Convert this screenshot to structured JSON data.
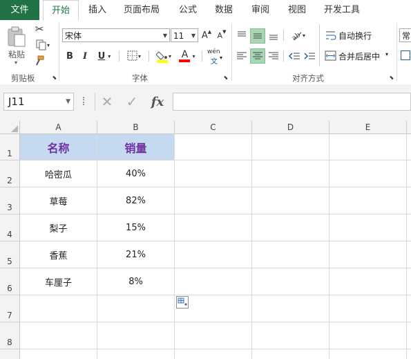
{
  "tabs": {
    "file": "文件",
    "home": "开始",
    "insert": "插入",
    "layout": "页面布局",
    "formulas": "公式",
    "data": "数据",
    "review": "审阅",
    "view": "视图",
    "developer": "开发工具"
  },
  "ribbon": {
    "paste_label": "粘贴",
    "clipboard_label": "剪贴板",
    "font_group_label": "字体",
    "align_group_label": "对齐方式",
    "font_name": "宋体",
    "font_size": "11",
    "wrap_text": "自动换行",
    "merge_center": "合并后居中",
    "number_format_partial": "常",
    "bold": "B",
    "italic": "I",
    "underline": "U",
    "font_color_glyph": "A",
    "wen_glyph": "wén",
    "wen_sub": "文",
    "grow_glyph": "A",
    "shrink_glyph": "A"
  },
  "formula_bar": {
    "name_box": "J11",
    "fx": "fx",
    "formula": ""
  },
  "colors": {
    "accent": "#217346",
    "header_fill": "#c5d9f1",
    "header_text": "#7030a0",
    "highlight": "#ffff00",
    "font_red": "#ff0000"
  },
  "columns": [
    "A",
    "B",
    "C",
    "D",
    "E"
  ],
  "rows": [
    "1",
    "2",
    "3",
    "4",
    "5",
    "6",
    "7",
    "8"
  ],
  "table": {
    "headers": [
      "名称",
      "销量"
    ],
    "data": [
      [
        "哈密瓜",
        "40%"
      ],
      [
        "草莓",
        "82%"
      ],
      [
        "梨子",
        "15%"
      ],
      [
        "香蕉",
        "21%"
      ],
      [
        "车厘子",
        "8%"
      ]
    ]
  }
}
